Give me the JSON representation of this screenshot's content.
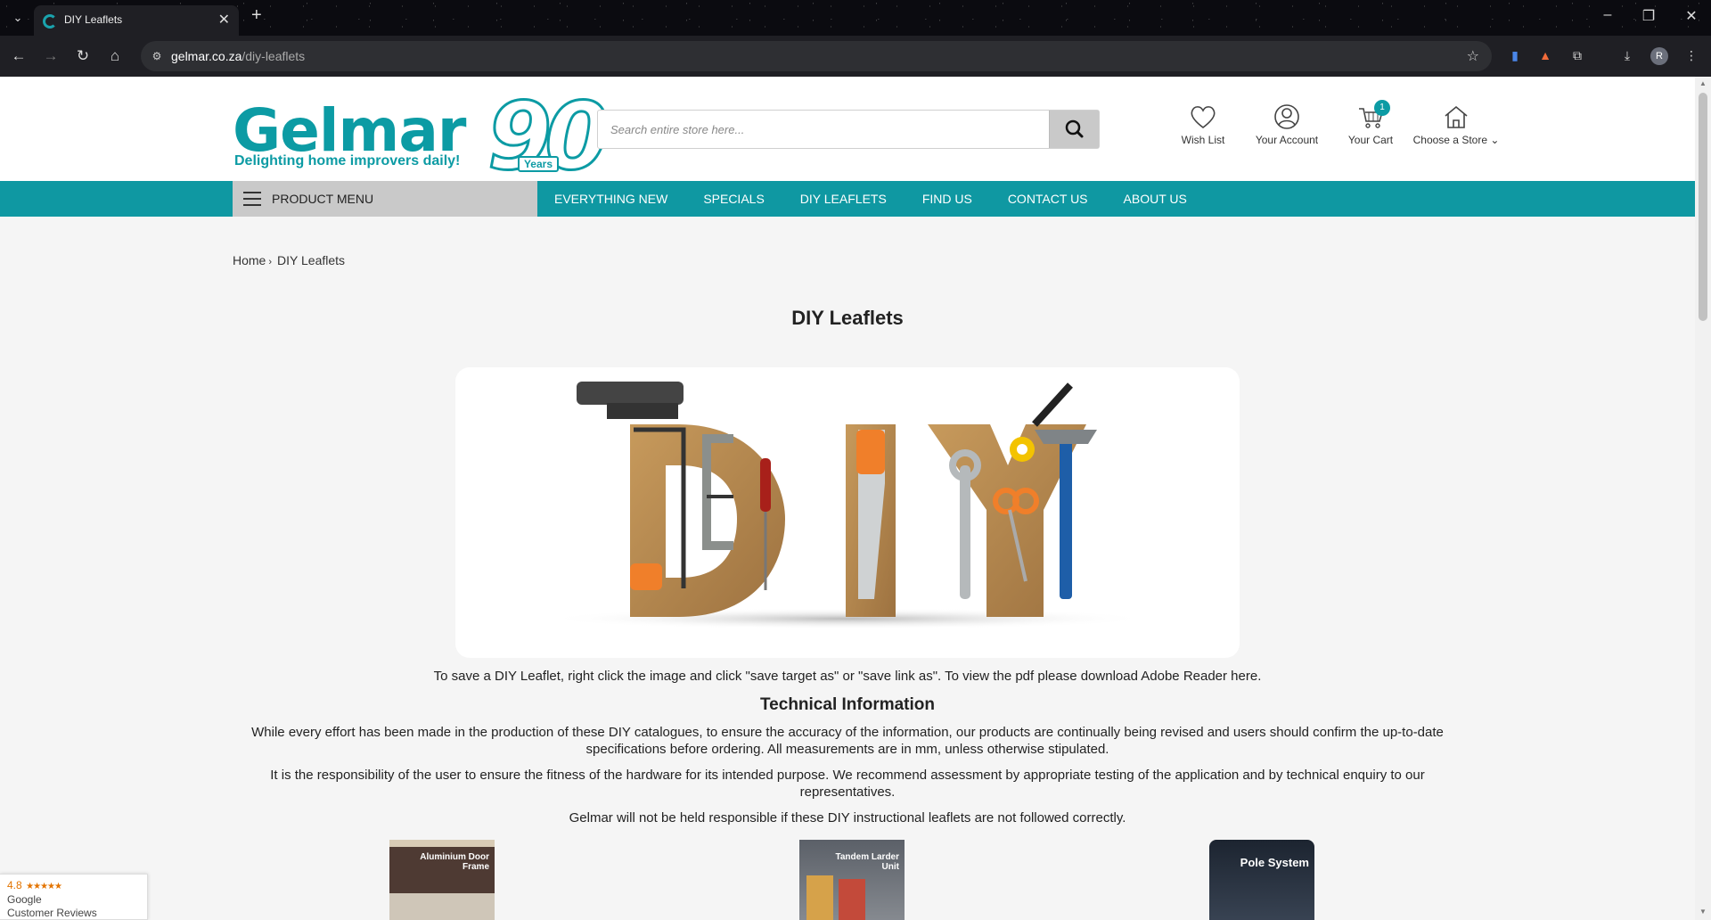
{
  "browser": {
    "tab_title": "DIY Leaflets",
    "tab_close": "✕",
    "new_tab": "+",
    "url_host": "gelmar.co.za",
    "url_path": "/diy-leaflets",
    "profile_initial": "R"
  },
  "header": {
    "logo_word": "Gelmar",
    "logo_tagline": "Delighting home improvers daily!",
    "logo_anniversary": "90",
    "logo_years": "Years",
    "search_placeholder": "Search entire store here...",
    "wish_list": "Wish List",
    "your_account": "Your Account",
    "your_cart": "Your Cart",
    "cart_count": "1",
    "choose_store": "Choose a Store ⌄"
  },
  "nav": {
    "product_menu": "PRODUCT MENU",
    "items": [
      "EVERYTHING NEW",
      "SPECIALS",
      "DIY LEAFLETS",
      "FIND US",
      "CONTACT US",
      "ABOUT US"
    ]
  },
  "breadcrumb": {
    "home": "Home",
    "sep": "›",
    "current": "DIY Leaflets"
  },
  "main": {
    "title": "DIY Leaflets",
    "save_note": "To save a DIY Leaflet, right click the image and click \"save target as\" or \"save link as\". To view the pdf please download Adobe Reader here.",
    "tech_title": "Technical Information",
    "para1": "While every effort has been made in the production of these DIY catalogues, to ensure the accuracy of the information, our products are continually being revised and users should confirm the up-to-date specifications before ordering. All measurements are in mm, unless otherwise stipulated.",
    "para2": "It is the responsibility of the user to ensure the fitness of the hardware for its intended purpose. We recommend assessment by appropriate testing of the application and by technical enquiry to our representatives.",
    "para3": "Gelmar will not be held responsible if these DIY instructional leaflets are not followed correctly."
  },
  "leaflets": [
    {
      "title": "Aluminium Door Frame"
    },
    {
      "title": "Tandem Larder Unit"
    },
    {
      "title": "Pole System"
    }
  ],
  "google_badge": {
    "rating": "4.8",
    "stars": "★★★★★",
    "line1": "Google",
    "line2": "Customer Reviews"
  },
  "colors": {
    "brand_teal": "#0f98a2",
    "menu_grey": "#c9c9c9"
  }
}
